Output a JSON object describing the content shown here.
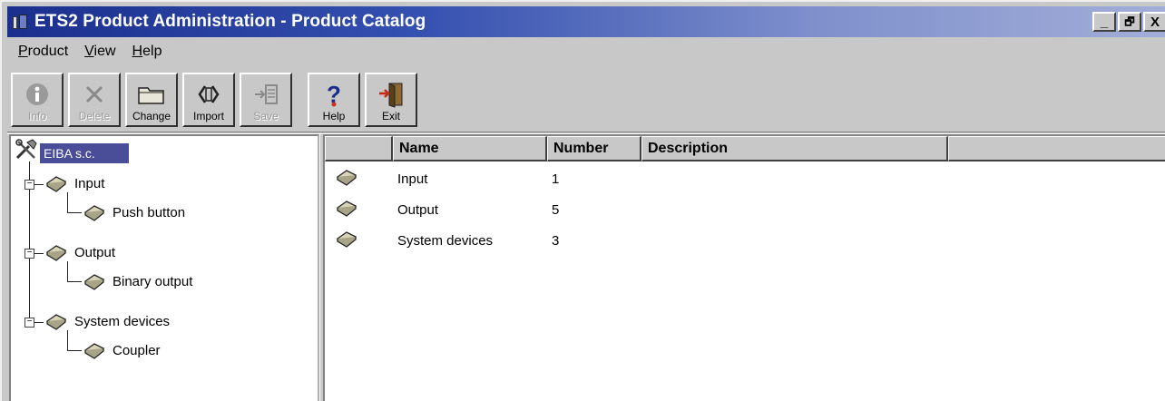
{
  "window": {
    "title": "ETS2 Product Administration - Product Catalog",
    "controls": [
      "_",
      "🗗",
      "X"
    ]
  },
  "menu": {
    "items": [
      {
        "label": "Product",
        "ul": "P",
        "rest": "roduct"
      },
      {
        "label": "View",
        "ul": "V",
        "rest": "iew"
      },
      {
        "label": "Help",
        "ul": "H",
        "rest": "elp"
      }
    ]
  },
  "toolbar": {
    "buttons": [
      {
        "label": "Info",
        "enabled": false,
        "icon": "info-icon"
      },
      {
        "label": "Delete",
        "enabled": false,
        "icon": "delete-icon"
      },
      {
        "label": "Change",
        "enabled": true,
        "icon": "folder-icon"
      },
      {
        "label": "Import",
        "enabled": true,
        "icon": "import-icon"
      },
      {
        "label": "Save",
        "enabled": false,
        "icon": "save-icon"
      },
      {
        "label": "Help",
        "enabled": true,
        "icon": "help-icon"
      },
      {
        "label": "Exit",
        "enabled": true,
        "icon": "exit-icon"
      }
    ]
  },
  "tree": {
    "root": "EIBA s.c.",
    "nodes": [
      {
        "label": "Input",
        "children": [
          "Push button"
        ]
      },
      {
        "label": "Output",
        "children": [
          "Binary output"
        ]
      },
      {
        "label": "System devices",
        "children": [
          "Coupler"
        ]
      }
    ]
  },
  "list": {
    "columns": [
      "",
      "Name",
      "Number",
      "Description",
      ""
    ],
    "rows": [
      {
        "name": "Input",
        "number": "1",
        "description": ""
      },
      {
        "name": "Output",
        "number": "5",
        "description": ""
      },
      {
        "name": "System devices",
        "number": "3",
        "description": ""
      }
    ]
  },
  "colors": {
    "title_gradient_start": "#1b2f8e",
    "title_gradient_end": "#a2aed8",
    "selection": "#4a4e98",
    "face": "#c8c8c8"
  }
}
